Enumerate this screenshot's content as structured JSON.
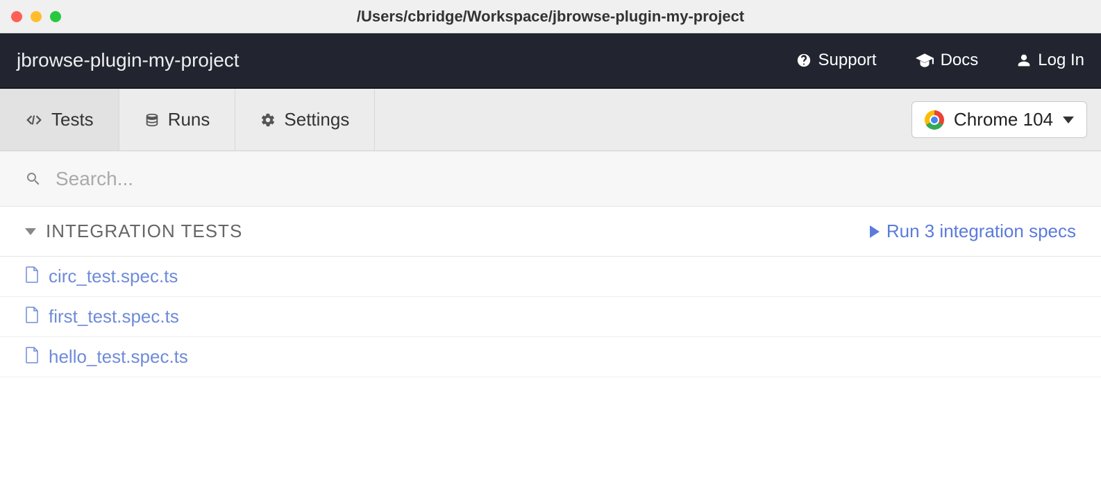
{
  "window": {
    "title": "/Users/cbridge/Workspace/jbrowse-plugin-my-project"
  },
  "header": {
    "project_name": "jbrowse-plugin-my-project",
    "links": {
      "support": "Support",
      "docs": "Docs",
      "login": "Log In"
    }
  },
  "toolbar": {
    "tabs": [
      {
        "label": "Tests",
        "active": true
      },
      {
        "label": "Runs",
        "active": false
      },
      {
        "label": "Settings",
        "active": false
      }
    ],
    "browser": {
      "label": "Chrome 104"
    }
  },
  "search": {
    "placeholder": "Search..."
  },
  "section": {
    "title": "INTEGRATION TESTS",
    "run_label": "Run 3 integration specs"
  },
  "specs": [
    {
      "name": "circ_test.spec.ts"
    },
    {
      "name": "first_test.spec.ts"
    },
    {
      "name": "hello_test.spec.ts"
    }
  ]
}
